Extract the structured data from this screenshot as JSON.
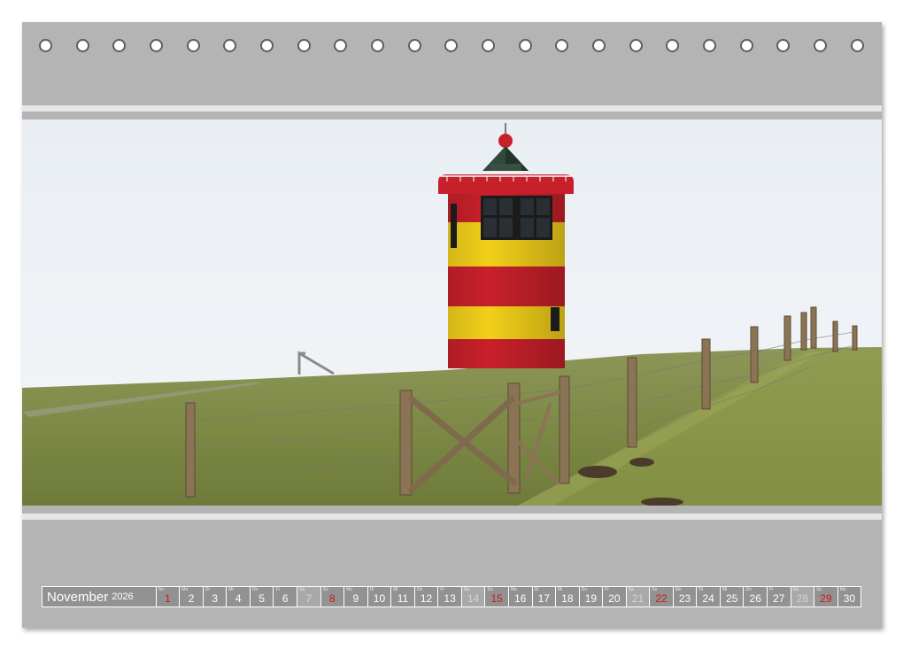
{
  "calendar": {
    "month": "November",
    "year": "2026",
    "days": [
      {
        "dow": "So",
        "num": "1",
        "type": "sun"
      },
      {
        "dow": "Mo",
        "num": "2",
        "type": "wd"
      },
      {
        "dow": "Di",
        "num": "3",
        "type": "wd"
      },
      {
        "dow": "Mi",
        "num": "4",
        "type": "wd"
      },
      {
        "dow": "Do",
        "num": "5",
        "type": "wd"
      },
      {
        "dow": "Fr",
        "num": "6",
        "type": "wd"
      },
      {
        "dow": "Sa",
        "num": "7",
        "type": "sat"
      },
      {
        "dow": "So",
        "num": "8",
        "type": "sun"
      },
      {
        "dow": "Mo",
        "num": "9",
        "type": "wd"
      },
      {
        "dow": "Di",
        "num": "10",
        "type": "wd"
      },
      {
        "dow": "Mi",
        "num": "11",
        "type": "wd"
      },
      {
        "dow": "Do",
        "num": "12",
        "type": "wd"
      },
      {
        "dow": "Fr",
        "num": "13",
        "type": "wd"
      },
      {
        "dow": "Sa",
        "num": "14",
        "type": "sat"
      },
      {
        "dow": "So",
        "num": "15",
        "type": "sun"
      },
      {
        "dow": "Mo",
        "num": "16",
        "type": "wd"
      },
      {
        "dow": "Di",
        "num": "17",
        "type": "wd"
      },
      {
        "dow": "Mi",
        "num": "18",
        "type": "wd"
      },
      {
        "dow": "Do",
        "num": "19",
        "type": "wd"
      },
      {
        "dow": "Fr",
        "num": "20",
        "type": "wd"
      },
      {
        "dow": "Sa",
        "num": "21",
        "type": "sat"
      },
      {
        "dow": "So",
        "num": "22",
        "type": "sun"
      },
      {
        "dow": "Mo",
        "num": "23",
        "type": "wd"
      },
      {
        "dow": "Di",
        "num": "24",
        "type": "wd"
      },
      {
        "dow": "Mi",
        "num": "25",
        "type": "wd"
      },
      {
        "dow": "Do",
        "num": "26",
        "type": "wd"
      },
      {
        "dow": "Fr",
        "num": "27",
        "type": "wd"
      },
      {
        "dow": "Sa",
        "num": "28",
        "type": "sat"
      },
      {
        "dow": "So",
        "num": "29",
        "type": "sun"
      },
      {
        "dow": "Mo",
        "num": "30",
        "type": "wd"
      }
    ]
  },
  "colors": {
    "sheet": "#b4b4b4",
    "cell": "#929292",
    "sunday_number": "#d01818",
    "lighthouse_red": "#c8202a",
    "lighthouse_yellow": "#f2cf1a"
  },
  "photo": {
    "subject": "lighthouse-icon"
  }
}
